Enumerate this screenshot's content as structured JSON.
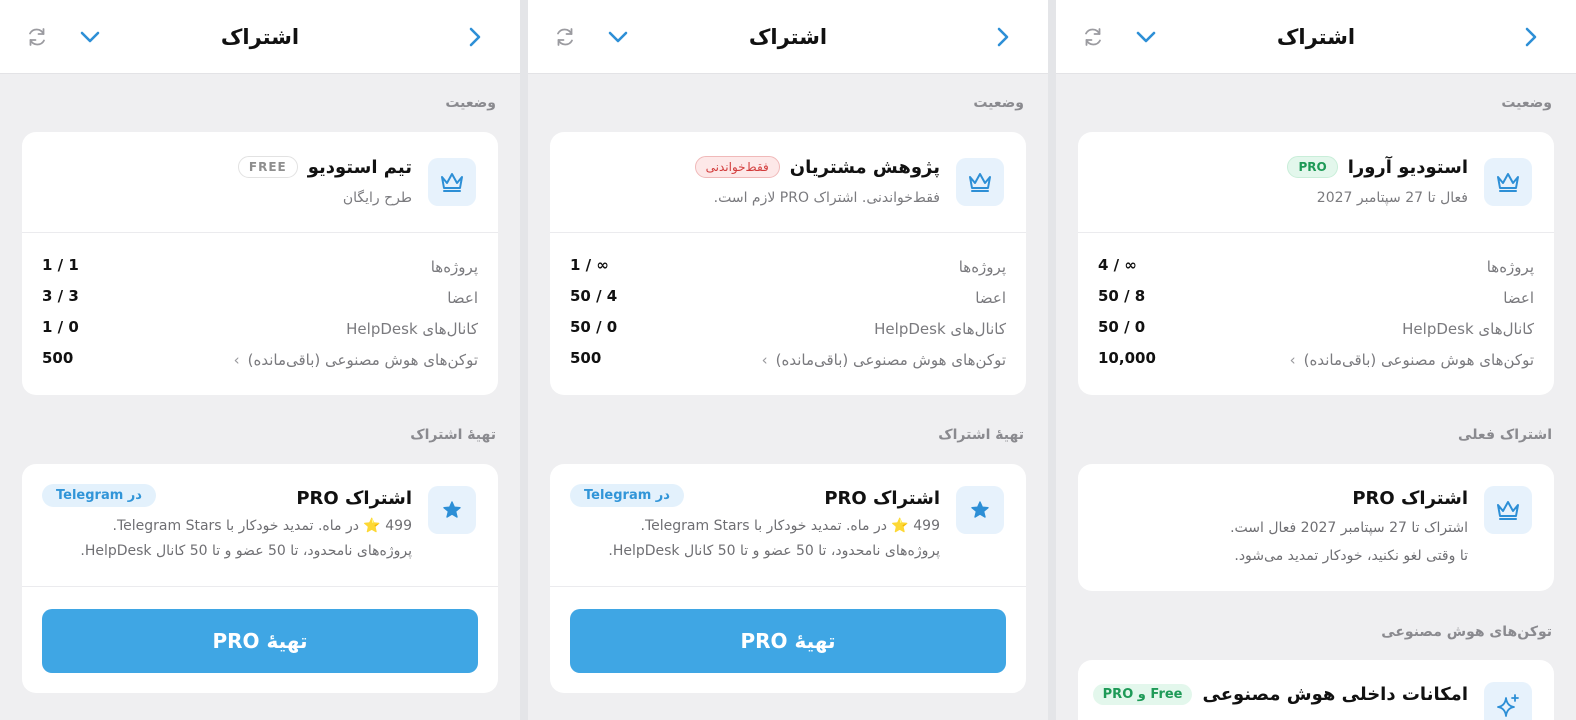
{
  "screens": [
    {
      "title": "اشتراک",
      "status_label": "وضعیت",
      "workspace": {
        "name": "تیم استودیو",
        "badge": "FREE",
        "subtitle": "طرح رایگان"
      },
      "rows": [
        {
          "label": "پروژه‌ها",
          "value": "1 / 1"
        },
        {
          "label": "اعضا",
          "value": "3 / 3"
        },
        {
          "label": "کانال‌های HelpDesk",
          "value": "1 / 0"
        },
        {
          "label": "توکن‌های هوش مصنوعی (باقی‌مانده)",
          "value": "500",
          "arrow": "›"
        }
      ],
      "offer_label": "تهیهٔ اشتراک",
      "offer": {
        "title": "اشتراک PRO",
        "badge": "در Telegram",
        "line1": "499 ⭐ در ماه. تمدید خودکار با Telegram Stars.",
        "line2": "پروژه‌های نامحدود، تا 50 عضو و تا 50 کانال HelpDesk."
      },
      "button": "تهیهٔ PRO"
    },
    {
      "title": "اشتراک",
      "status_label": "وضعیت",
      "workspace": {
        "name": "پژوهش مشتریان",
        "badge": "فقط‌خواندنی",
        "subtitle": "فقط‌خواندنی. اشتراک PRO لازم است."
      },
      "rows": [
        {
          "label": "پروژه‌ها",
          "value": "1 / ∞"
        },
        {
          "label": "اعضا",
          "value": "50 / 4"
        },
        {
          "label": "کانال‌های HelpDesk",
          "value": "50 / 0"
        },
        {
          "label": "توکن‌های هوش مصنوعی (باقی‌مانده)",
          "value": "500",
          "arrow": "›"
        }
      ],
      "offer_label": "تهیهٔ اشتراک",
      "offer": {
        "title": "اشتراک PRO",
        "badge": "در Telegram",
        "line1": "499 ⭐ در ماه. تمدید خودکار با Telegram Stars.",
        "line2": "پروژه‌های نامحدود، تا 50 عضو و تا 50 کانال HelpDesk."
      },
      "button": "تهیهٔ PRO"
    },
    {
      "title": "اشتراک",
      "status_label": "وضعیت",
      "workspace": {
        "name": "استودیو آرورا",
        "badge": "PRO",
        "subtitle": "فعال تا 27 سپتامبر 2027"
      },
      "rows": [
        {
          "label": "پروژه‌ها",
          "value": "4 / ∞"
        },
        {
          "label": "اعضا",
          "value": "50 / 8"
        },
        {
          "label": "کانال‌های HelpDesk",
          "value": "50 / 0"
        },
        {
          "label": "توکن‌های هوش مصنوعی (باقی‌مانده)",
          "value": "10,000",
          "arrow": "›"
        }
      ],
      "current_label": "اشتراک فعلی",
      "current": {
        "title": "اشتراک PRO",
        "line1": "اشتراک تا 27 سپتامبر 2027 فعال است.",
        "line2": "تا وقتی لغو نکنید، خودکار تمدید می‌شود."
      },
      "ai_label": "توکن‌های هوش مصنوعی",
      "ai": {
        "title": "امکانات داخلی هوش مصنوعی",
        "badge": "Free و PRO"
      }
    }
  ],
  "colors": {
    "accent": "#3fa6e4",
    "pro_green": "#1e9a57",
    "readonly_red": "#d23b3b"
  },
  "icons": [
    "chevron-right-icon",
    "chevron-down-icon",
    "refresh-icon",
    "crown-icon",
    "star-icon",
    "sparkle-icon"
  ]
}
